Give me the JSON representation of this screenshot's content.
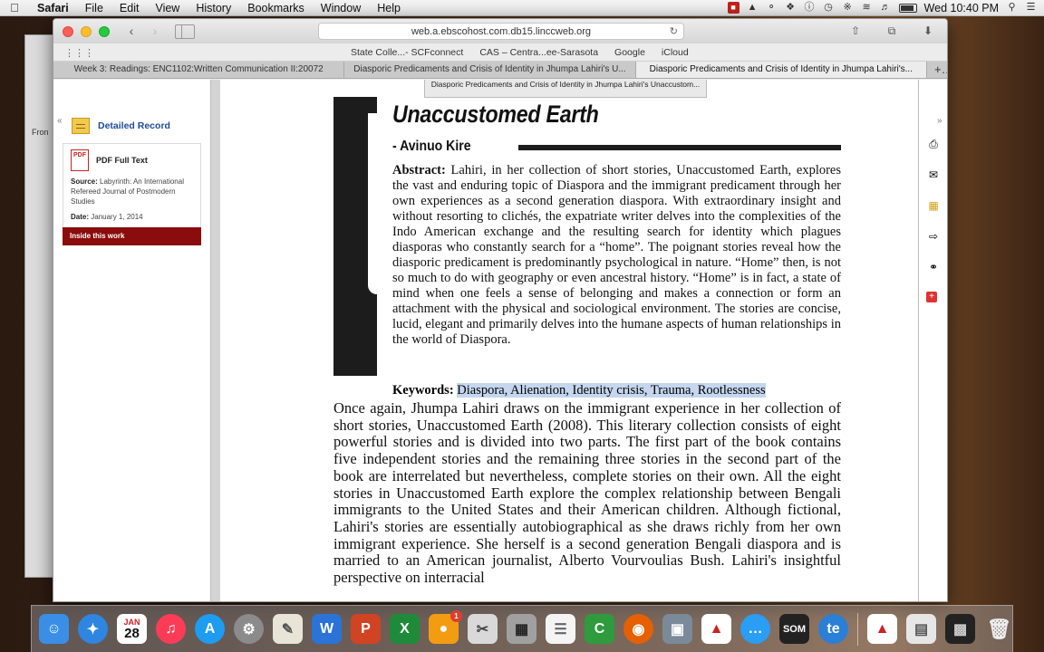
{
  "menubar": {
    "app": "Safari",
    "items": [
      "File",
      "Edit",
      "View",
      "History",
      "Bookmarks",
      "Window",
      "Help"
    ],
    "clock": "Wed 10:40 PM"
  },
  "desktop": {
    "partial_window_label": "Fron"
  },
  "browser": {
    "url": "web.a.ebscohost.com.db15.linccweb.org",
    "bookmarks": [
      "State Colle...- SCFconnect",
      "CAS – Centra...ee-Sarasota",
      "Google",
      "iCloud"
    ],
    "tabs": [
      {
        "label": "Week 3: Readings: ENC1102:Written Communication II:20072",
        "active": false
      },
      {
        "label": "Diasporic Predicaments and Crisis of Identity in Jhumpa Lahiri's U...",
        "active": false
      },
      {
        "label": "Diasporic Predicaments and Crisis of Identity in Jhumpa Lahiri's...",
        "active": true
      }
    ]
  },
  "left_panel": {
    "detailed_record": "Detailed Record",
    "pdf_full_text": "PDF Full Text",
    "source_label": "Source:",
    "source_value": "Labyrinth: An International Refereed Journal of Postmodern Studies",
    "date_label": "Date:",
    "date_value": "January 1, 2014",
    "inside_button": "Inside this work"
  },
  "pdf": {
    "window_title": "Diasporic Predicaments and Crisis of Identity in Jhumpa Lahiri's Unaccustom...",
    "title": "Unaccustomed Earth",
    "author": "- Avinuo Kire",
    "abstract_label": "Abstract:",
    "abstract_text": "Lahiri, in her collection of short stories, Unaccustomed Earth, explores the vast and enduring topic of Diaspora and the immigrant predicament through her own experiences as a second generation diaspora. With extraordinary insight and without resorting to clichés, the expatriate writer delves into the complexities of the Indo American exchange and the resulting search for identity which plagues diasporas who constantly search for a “home”. The poignant stories reveal how the diasporic predicament is predominantly psychological in nature. “Home” then, is not so much to do with geography or even ancestral history. “Home” is in fact, a state of mind when one feels a sense of belonging and makes a connection or form an attachment with the physical and sociological environment. The stories are concise, lucid, elegant and primarily delves into the humane aspects of human relationships in the world of Diaspora.",
    "keywords_label": "Keywords:",
    "keywords_text": "Diaspora, Alienation, Identity crisis, Trauma, Rootlessness",
    "body_text": "Once again, Jhumpa Lahiri draws on the immigrant experience in her collection of short stories, Unaccustomed Earth (2008). This literary collection consists of eight powerful stories and is divided into two parts. The first part of the book contains five independent stories and the remaining three stories in the second part of the book are interrelated but nevertheless, complete stories on their own. All the eight stories in Unaccustomed Earth explore the complex relationship between Bengali immigrants to the United States and their American children. Although fictional, Lahiri's stories are essentially autobiographical as she draws richly from her own immigrant experience. She herself is a second generation Bengali diaspora and is married to an American journalist, Alberto Vourvoulias Bush. Lahiri's insightful perspective on interracial"
  },
  "dock": {
    "calendar_month": "JAN",
    "calendar_day": "28",
    "badge_count": "1"
  },
  "colors": {
    "inside_button_bg": "#8b0c0c",
    "link_blue": "#1d4a9b",
    "highlight": "#c5d6ef"
  }
}
